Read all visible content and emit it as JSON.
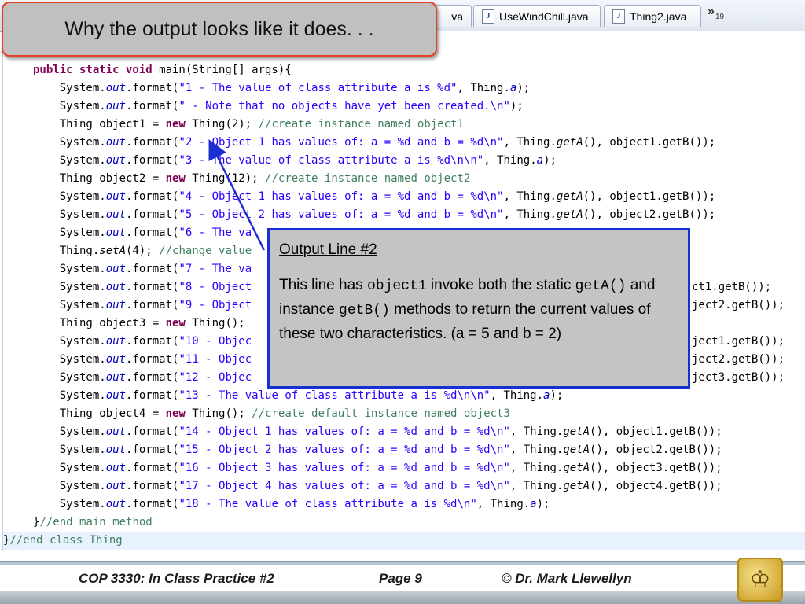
{
  "editor_tabs": [
    {
      "label": "va",
      "icon": "java-file-icon"
    },
    {
      "label": "UseWindChill.java",
      "icon": "java-file-icon"
    },
    {
      "label": "Thing2.java",
      "icon": "java-file-icon"
    }
  ],
  "overflow": {
    "symbol": "»",
    "count": "19"
  },
  "title": "Why the output looks like it does. . .",
  "code_lines": {
    "l0": "public static void main(String[] args){",
    "l1_pre": "    System.",
    "l1_fld": "out",
    "l1_mid": ".format(",
    "l1_str": "\"1 - The value of class attribute a is %d\"",
    "l1_post": ", Thing.",
    "l1_a": "a",
    "l1_end": ");",
    "l2": "    System.out.format(\" - Note that no objects have yet been created.\\n\");",
    "l3": "    Thing object1 = new Thing(2); //create instance named object1",
    "l4": "    System.out.format(\"2 - Object 1 has values of: a = %d and b = %d\\n\", Thing.getA(), object1.getB());",
    "l5": "    System.out.format(\"3 - The value of class attribute a is %d\\n\\n\", Thing.a);",
    "l6": "    Thing object2 = new Thing(12); //create instance named object2",
    "l7": "    System.out.format(\"4 - Object 1 has values of: a = %d and b = %d\\n\", Thing.getA(), object1.getB());",
    "l8": "    System.out.format(\"5 - Object 2 has values of: a = %d and b = %d\\n\", Thing.getA(), object2.getB());",
    "l9": "    System.out.format(\"6 - The va",
    "l10": "    Thing.setA(4); //change value",
    "l11": "    System.out.format(\"7 - The va",
    "l12a": "    System.out.format(\"8 - Object",
    "l12b": "ct1.getB());",
    "l13a": "    System.out.format(\"9 - Object",
    "l13b": "ject2.getB());",
    "l14": "    Thing object3 = new Thing();",
    "l15a": "    System.out.format(\"10 - Objec",
    "l15b": "ject1.getB());",
    "l16a": "    System.out.format(\"11 - Objec",
    "l16b": "ject2.getB());",
    "l17a": "    System.out.format(\"12 - Objec",
    "l17b": "ject3.getB());",
    "l18": "    System.out.format(\"13 - The value of class attribute a is %d\\n\\n\", Thing.a);",
    "l19": "    Thing object4 = new Thing(); //create default instance named object3",
    "l20": "    System.out.format(\"14 - Object 1 has values of: a = %d and b = %d\\n\", Thing.getA(), object1.getB());",
    "l21": "    System.out.format(\"15 - Object 2 has values of: a = %d and b = %d\\n\", Thing.getA(), object2.getB());",
    "l22": "    System.out.format(\"16 - Object 3 has values of: a = %d and b = %d\\n\", Thing.getA(), object3.getB());",
    "l23": "    System.out.format(\"17 - Object 4 has values of: a = %d and b = %d\\n\", Thing.getA(), object4.getB());",
    "l24": "    System.out.format(\"18 - The value of class attribute a is %d\\n\", Thing.a);",
    "l25": "  }//end main method",
    "l26": "}//end class Thing"
  },
  "callout": {
    "heading": "Output Line #2",
    "t1": "This line has ",
    "c1": "object1",
    "t2": " invoke both the static ",
    "c2": "getA()",
    "t3": " and  instance ",
    "c3": "getB()",
    "t4": " methods  to return the current values of these two characteristics. (a = 5 and b = 2)"
  },
  "footer": {
    "course": "COP 3330:  In Class Practice #2",
    "page": "Page 9",
    "author": "© Dr. Mark Llewellyn",
    "logo": "ucf-pegasus-logo"
  },
  "colors": {
    "title_border": "#e8401c",
    "callout_border": "#1a2fd1",
    "keyword": "#7f0055",
    "comment": "#3f7f5f",
    "string": "#2a00ff"
  }
}
